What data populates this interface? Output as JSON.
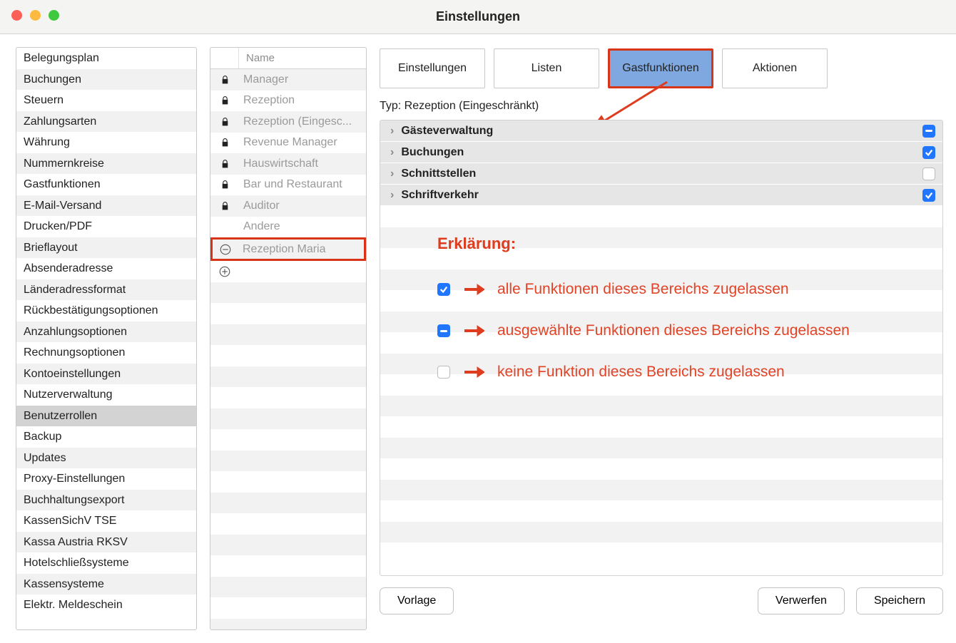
{
  "window": {
    "title": "Einstellungen"
  },
  "sidebar": {
    "items": [
      {
        "label": "Belegungsplan"
      },
      {
        "label": "Buchungen"
      },
      {
        "label": "Steuern"
      },
      {
        "label": "Zahlungsarten"
      },
      {
        "label": "Währung"
      },
      {
        "label": "Nummernkreise"
      },
      {
        "label": "Gastfunktionen"
      },
      {
        "label": "E-Mail-Versand"
      },
      {
        "label": "Drucken/PDF"
      },
      {
        "label": "Brieflayout"
      },
      {
        "label": "Absenderadresse"
      },
      {
        "label": "Länderadressformat"
      },
      {
        "label": "Rückbestätigungsoptionen"
      },
      {
        "label": "Anzahlungsoptionen"
      },
      {
        "label": "Rechnungsoptionen"
      },
      {
        "label": "Kontoeinstellungen"
      },
      {
        "label": "Nutzerverwaltung"
      },
      {
        "label": "Benutzerrollen",
        "selected": true
      },
      {
        "label": "Backup"
      },
      {
        "label": "Updates"
      },
      {
        "label": "Proxy-Einstellungen"
      },
      {
        "label": "Buchhaltungsexport"
      },
      {
        "label": "KassenSichV TSE"
      },
      {
        "label": "Kassa Austria RKSV"
      },
      {
        "label": "Hotelschließsysteme"
      },
      {
        "label": "Kassensysteme"
      },
      {
        "label": "Elektr. Meldeschein"
      }
    ]
  },
  "roles": {
    "header_name": "Name",
    "items": [
      {
        "name": "Manager",
        "icon": "lock"
      },
      {
        "name": "Rezeption",
        "icon": "lock"
      },
      {
        "name": "Rezeption (Eingesc...",
        "icon": "lock"
      },
      {
        "name": "Revenue Manager",
        "icon": "lock"
      },
      {
        "name": "Hauswirtschaft",
        "icon": "lock"
      },
      {
        "name": "Bar und Restaurant",
        "icon": "lock"
      },
      {
        "name": "Auditor",
        "icon": "lock"
      },
      {
        "name": "Andere",
        "icon": "none"
      },
      {
        "name": "Rezeption Maria",
        "icon": "minus",
        "selected": true
      }
    ],
    "add_icon": "plus"
  },
  "tabs": {
    "items": [
      {
        "label": "Einstellungen"
      },
      {
        "label": "Listen"
      },
      {
        "label": "Gastfunktionen",
        "active": true
      },
      {
        "label": "Aktionen"
      }
    ]
  },
  "type_line": "Typ: Rezeption (Eingeschränkt)",
  "sections": [
    {
      "label": "Gästeverwaltung",
      "state": "indeterminate"
    },
    {
      "label": "Buchungen",
      "state": "checked"
    },
    {
      "label": "Schnittstellen",
      "state": "empty"
    },
    {
      "label": "Schriftverkehr",
      "state": "checked"
    }
  ],
  "explanation": {
    "title": "Erklärung:",
    "rows": [
      {
        "state": "checked",
        "text": "alle Funktionen dieses Bereichs zugelassen"
      },
      {
        "state": "indeterminate",
        "text": "ausgewählte Funktionen dieses Bereichs zugelassen"
      },
      {
        "state": "empty",
        "text": "keine Funktion dieses Bereichs zugelassen"
      }
    ]
  },
  "buttons": {
    "vorlage": "Vorlage",
    "verwerfen": "Verwerfen",
    "speichern": "Speichern"
  }
}
